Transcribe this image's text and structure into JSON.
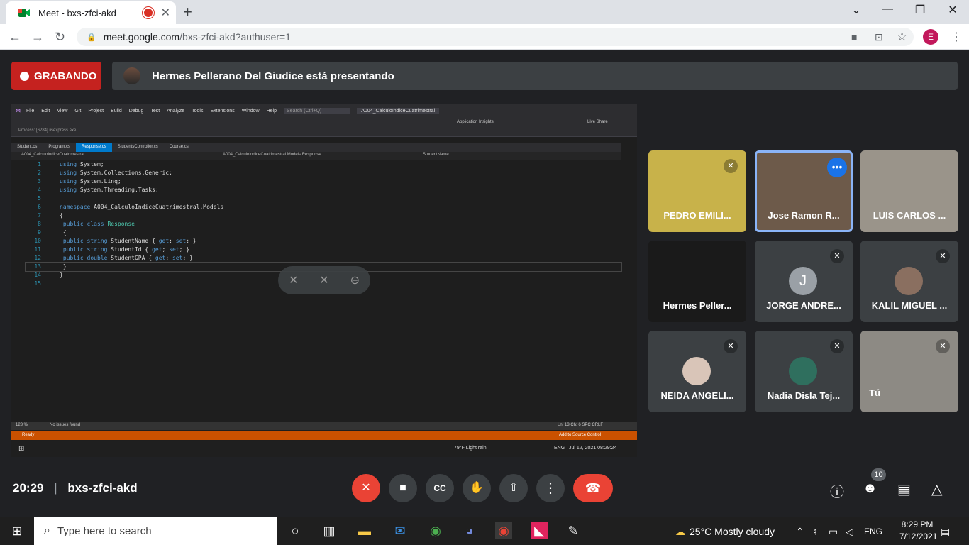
{
  "browser": {
    "tab_title": "Meet - bxs-zfci-akd",
    "url_host": "meet.google.com",
    "url_path": "/bxs-zfci-akd?authuser=1",
    "profile_initial": "E"
  },
  "meet": {
    "recording_label": "GRABANDO",
    "presenter_text": "Hermes Pellerano Del Giudice está presentando",
    "clock": "20:29",
    "meeting_code": "bxs-zfci-akd",
    "participants_badge": "10"
  },
  "participants": [
    {
      "name": "PEDRO EMILI...",
      "muted": true
    },
    {
      "name": "Jose Ramon R...",
      "muted": false,
      "speaking": true
    },
    {
      "name": "LUIS CARLOS ...",
      "muted": false
    },
    {
      "name": "Hermes Peller...",
      "muted": false
    },
    {
      "name": "JORGE ANDRE...",
      "muted": true,
      "initial": "J"
    },
    {
      "name": "KALIL MIGUEL ...",
      "muted": true
    },
    {
      "name": "NEIDA ANGELI...",
      "muted": true
    },
    {
      "name": "Nadia Disla Tej...",
      "muted": true
    },
    {
      "name": "Tú",
      "muted": true
    }
  ],
  "vs": {
    "menu": [
      "File",
      "Edit",
      "View",
      "Git",
      "Project",
      "Build",
      "Debug",
      "Test",
      "Analyze",
      "Tools",
      "Extensions",
      "Window",
      "Help"
    ],
    "search": "Search (Ctrl+Q)",
    "solution": "A004_CalculoIndiceCuatrimestral",
    "process": "Process: [6284] iisexpress.exe",
    "tabs": [
      "Student.cs",
      "Program.cs",
      "Response.cs",
      "StudentsController.cs",
      "Course.cs"
    ],
    "nav_left": "A004_CalculoIndiceCuatrimestral",
    "nav_mid": "A004_CalculoIndiceCuatrimestral.Models.Response",
    "nav_right": "StudentName",
    "zoom": "123 %",
    "issues": "No issues found",
    "position": "Ln: 13   Ch: 6   SPC   CRLF",
    "ready": "Ready",
    "source_control": "Add to Source Control",
    "live_share": "Live Share",
    "app_insights": "Application Insights",
    "weather": "79°F  Light rain",
    "lang": "ENG",
    "datetime": "Jul 12, 2021  08:29:24"
  },
  "win": {
    "search_placeholder": "Type here to search",
    "weather": "25°C  Mostly cloudy",
    "lang": "ENG",
    "time": "8:29 PM",
    "date": "7/12/2021"
  }
}
